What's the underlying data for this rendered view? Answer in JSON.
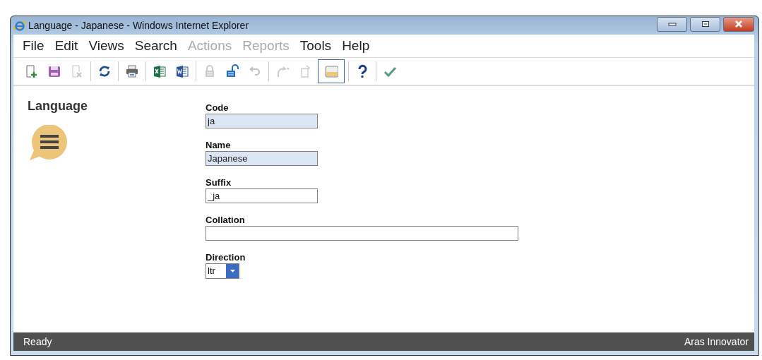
{
  "window": {
    "title": "Language - Japanese - Windows Internet Explorer"
  },
  "menu": [
    {
      "label": "File",
      "disabled": false
    },
    {
      "label": "Edit",
      "disabled": false
    },
    {
      "label": "Views",
      "disabled": false
    },
    {
      "label": "Search",
      "disabled": false
    },
    {
      "label": "Actions",
      "disabled": true
    },
    {
      "label": "Reports",
      "disabled": true
    },
    {
      "label": "Tools",
      "disabled": false
    },
    {
      "label": "Help",
      "disabled": false
    }
  ],
  "toolbar": [
    {
      "kind": "new",
      "disabled": false,
      "pressed": false
    },
    {
      "kind": "save",
      "disabled": false,
      "pressed": false
    },
    {
      "kind": "delete",
      "disabled": true,
      "pressed": false
    },
    {
      "kind": "separator"
    },
    {
      "kind": "refresh",
      "disabled": false,
      "pressed": false
    },
    {
      "kind": "separator"
    },
    {
      "kind": "print",
      "disabled": false,
      "pressed": false
    },
    {
      "kind": "separator"
    },
    {
      "kind": "excel",
      "disabled": false,
      "pressed": false
    },
    {
      "kind": "word",
      "disabled": false,
      "pressed": false
    },
    {
      "kind": "separator"
    },
    {
      "kind": "lock",
      "disabled": true,
      "pressed": false
    },
    {
      "kind": "unlock",
      "disabled": false,
      "pressed": false
    },
    {
      "kind": "undo",
      "disabled": true,
      "pressed": false
    },
    {
      "kind": "separator"
    },
    {
      "kind": "promote",
      "disabled": true,
      "pressed": false
    },
    {
      "kind": "copy",
      "disabled": true,
      "pressed": false
    },
    {
      "kind": "panel",
      "disabled": false,
      "pressed": true
    },
    {
      "kind": "separator"
    },
    {
      "kind": "help",
      "disabled": false,
      "pressed": false
    },
    {
      "kind": "separator"
    },
    {
      "kind": "done",
      "disabled": false,
      "pressed": false
    }
  ],
  "sidebar": {
    "title": "Language"
  },
  "form": {
    "fields": [
      {
        "kind": "text",
        "label": "Code",
        "value": "ja",
        "readonly": true,
        "wide": false
      },
      {
        "kind": "text",
        "label": "Name",
        "value": "Japanese",
        "readonly": true,
        "wide": false
      },
      {
        "kind": "text",
        "label": "Suffix",
        "value": "_ja",
        "readonly": false,
        "wide": false
      },
      {
        "kind": "text",
        "label": "Collation",
        "readonly": false,
        "wide": true
      },
      {
        "kind": "select",
        "label": "Direction",
        "value": "ltr"
      }
    ]
  },
  "status_bar": {
    "left": "Ready",
    "right": "Aras Innovator"
  }
}
